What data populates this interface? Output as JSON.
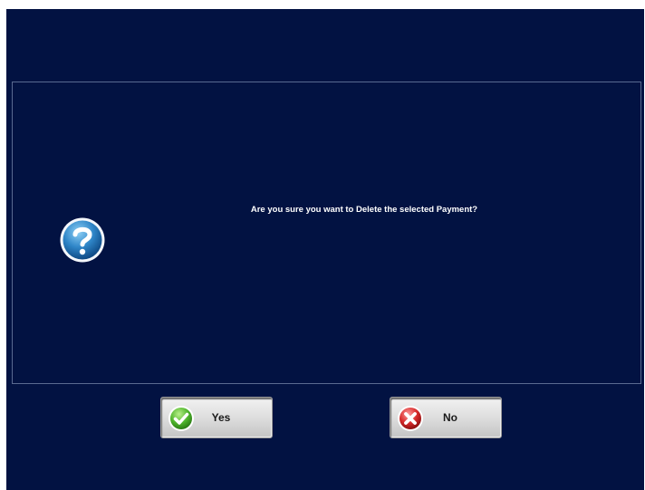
{
  "dialog": {
    "message": "Are you sure you want to Delete the selected Payment?",
    "icon": "question-icon"
  },
  "buttons": {
    "yes": {
      "label": "Yes",
      "icon": "check-icon"
    },
    "no": {
      "label": "No",
      "icon": "x-icon"
    }
  },
  "colors": {
    "background": "#021242",
    "panel_border": "#5a6a90",
    "text": "#ffffff",
    "button_face": "#dedede"
  }
}
